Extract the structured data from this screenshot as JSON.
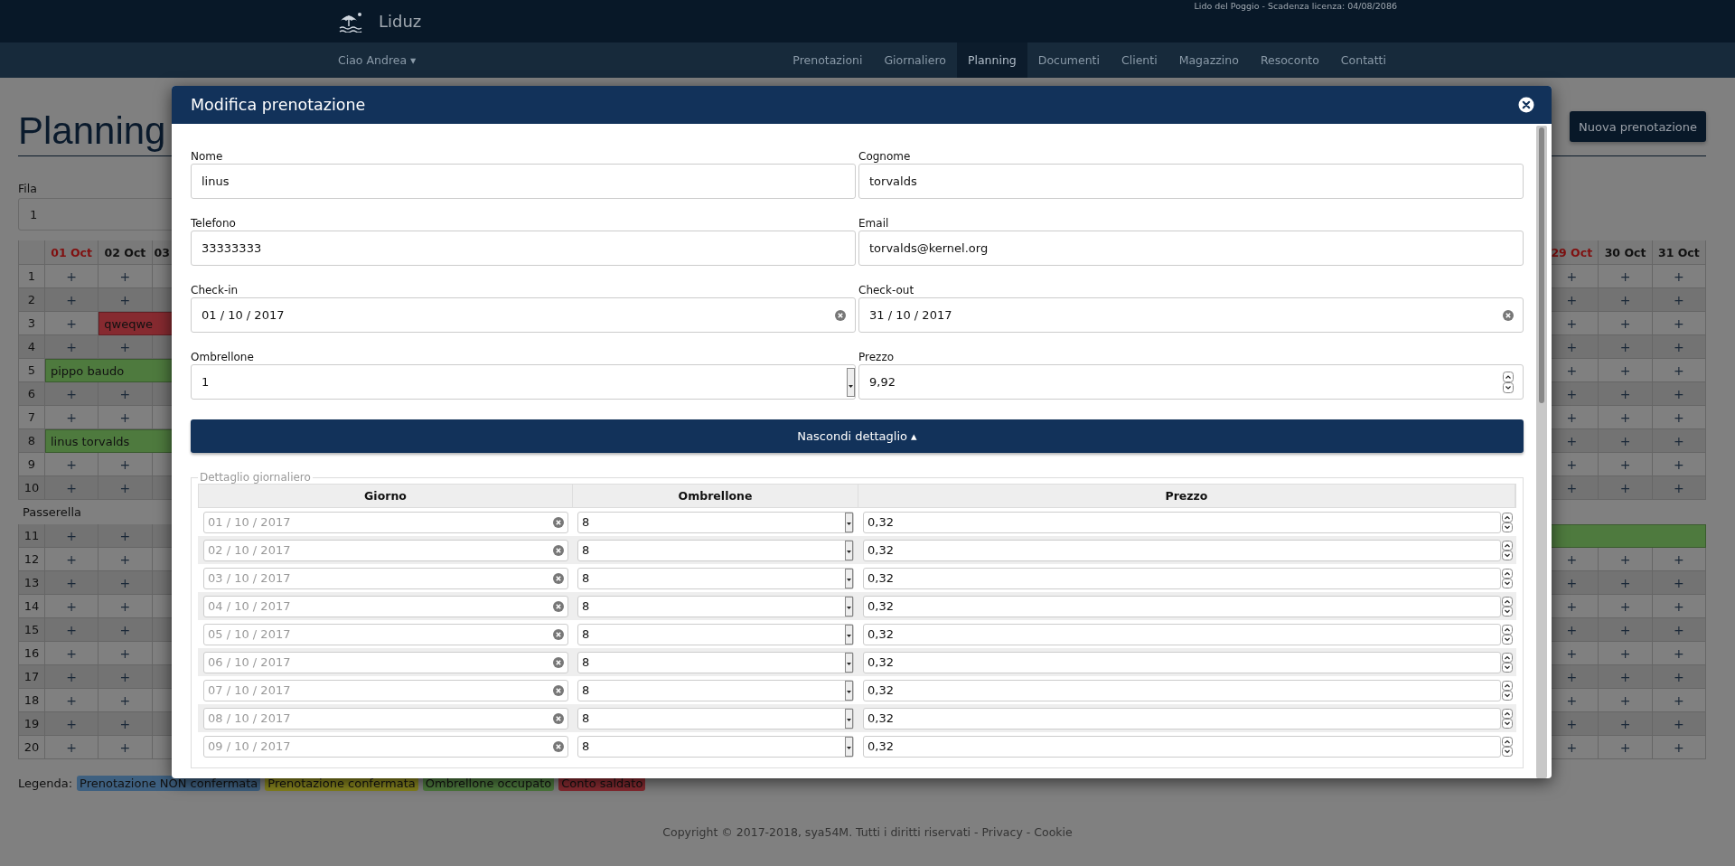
{
  "topbar": {
    "brand": "Liduz",
    "license": "Lido del Poggio - Scadenza licenza: 04/08/2086"
  },
  "nav": {
    "user": "Ciao Andrea ▾",
    "items": [
      {
        "label": "Prenotazioni",
        "selected": false
      },
      {
        "label": "Giornaliero",
        "selected": false
      },
      {
        "label": "Planning",
        "selected": true
      },
      {
        "label": "Documenti",
        "selected": false
      },
      {
        "label": "Clienti",
        "selected": false
      },
      {
        "label": "Magazzino",
        "selected": false
      },
      {
        "label": "Resoconto",
        "selected": false
      },
      {
        "label": "Contatti",
        "selected": false
      }
    ]
  },
  "page": {
    "title": "Planning",
    "new_button": "Nuova prenotazione",
    "fila": {
      "label": "Fila",
      "value": "1"
    }
  },
  "planning": {
    "columns_left": [
      {
        "label": "01 Oct",
        "weekend": true
      },
      {
        "label": "02 Oct",
        "weekend": false
      },
      {
        "label": "03",
        "weekend": false
      }
    ],
    "columns_right": [
      {
        "label": "29 Oct",
        "weekend": true
      },
      {
        "label": "30 Oct",
        "weekend": false
      },
      {
        "label": "31 Oct",
        "weekend": false
      }
    ],
    "rows": [
      {
        "kind": "row",
        "label": "1",
        "left": [
          {
            "kind": "free",
            "text": "+"
          },
          {
            "kind": "free",
            "text": "+"
          }
        ],
        "right": [
          {
            "kind": "free",
            "text": "+"
          },
          {
            "kind": "free",
            "text": "+"
          },
          {
            "kind": "free",
            "text": "+"
          }
        ]
      },
      {
        "kind": "row",
        "label": "2",
        "left": [
          {
            "kind": "free",
            "text": "+"
          },
          {
            "kind": "free",
            "text": "+"
          }
        ],
        "right": [
          {
            "kind": "free",
            "text": "+"
          },
          {
            "kind": "free",
            "text": "+"
          },
          {
            "kind": "free",
            "text": "+"
          }
        ]
      },
      {
        "kind": "row",
        "label": "3",
        "left": [
          {
            "kind": "free",
            "text": "+"
          },
          {
            "kind": "booking",
            "text": "qweqwe",
            "color": "#862a30"
          }
        ],
        "right": [
          {
            "kind": "free",
            "text": "+"
          },
          {
            "kind": "free",
            "text": "+"
          },
          {
            "kind": "free",
            "text": "+"
          }
        ]
      },
      {
        "kind": "row",
        "label": "4",
        "left": [
          {
            "kind": "free",
            "text": "+"
          },
          {
            "kind": "free",
            "text": "+"
          }
        ],
        "right": [
          {
            "kind": "free",
            "text": "+"
          },
          {
            "kind": "free",
            "text": "+"
          },
          {
            "kind": "free",
            "text": "+"
          }
        ]
      },
      {
        "kind": "row",
        "label": "5",
        "left": [
          {
            "kind": "booking",
            "text": "pippo baudo",
            "color": "#4e7a3e"
          }
        ],
        "right": [
          {
            "kind": "free",
            "text": "+"
          },
          {
            "kind": "free",
            "text": "+"
          },
          {
            "kind": "free",
            "text": "+"
          }
        ]
      },
      {
        "kind": "row",
        "label": "6",
        "left": [
          {
            "kind": "free",
            "text": "+"
          },
          {
            "kind": "free",
            "text": "+"
          }
        ],
        "right": [
          {
            "kind": "free",
            "text": "+"
          },
          {
            "kind": "free",
            "text": "+"
          },
          {
            "kind": "free",
            "text": "+"
          }
        ]
      },
      {
        "kind": "row",
        "label": "7",
        "left": [
          {
            "kind": "free",
            "text": "+"
          },
          {
            "kind": "free",
            "text": "+"
          }
        ],
        "right": [
          {
            "kind": "free",
            "text": "+"
          },
          {
            "kind": "free",
            "text": "+"
          },
          {
            "kind": "free",
            "text": "+"
          }
        ]
      },
      {
        "kind": "row",
        "label": "8",
        "left": [
          {
            "kind": "booking",
            "text": "linus torvalds",
            "color": "#4e7a3e"
          }
        ],
        "right": [
          {
            "kind": "free",
            "text": "+"
          },
          {
            "kind": "free",
            "text": "+"
          },
          {
            "kind": "free",
            "text": "+"
          }
        ]
      },
      {
        "kind": "row",
        "label": "9",
        "left": [
          {
            "kind": "free",
            "text": "+"
          },
          {
            "kind": "free",
            "text": "+"
          }
        ],
        "right": [
          {
            "kind": "free",
            "text": "+"
          },
          {
            "kind": "free",
            "text": "+"
          },
          {
            "kind": "free",
            "text": "+"
          }
        ]
      },
      {
        "kind": "row",
        "label": "10",
        "left": [
          {
            "kind": "free",
            "text": "+"
          },
          {
            "kind": "free",
            "text": "+"
          }
        ],
        "right": [
          {
            "kind": "free",
            "text": "+"
          },
          {
            "kind": "free",
            "text": "+"
          },
          {
            "kind": "free",
            "text": "+"
          }
        ]
      },
      {
        "kind": "section",
        "label": "Passerella"
      },
      {
        "kind": "row",
        "label": "11",
        "left": [
          {
            "kind": "free",
            "text": "+"
          },
          {
            "kind": "free",
            "text": "+"
          }
        ],
        "right": [
          {
            "kind": "booking",
            "color": "#4e7a3e"
          }
        ]
      },
      {
        "kind": "row",
        "label": "12",
        "left": [
          {
            "kind": "free",
            "text": "+"
          },
          {
            "kind": "free",
            "text": "+"
          }
        ],
        "right": [
          {
            "kind": "free",
            "text": "+"
          },
          {
            "kind": "free",
            "text": "+"
          },
          {
            "kind": "free",
            "text": "+"
          }
        ]
      },
      {
        "kind": "row",
        "label": "13",
        "left": [
          {
            "kind": "free",
            "text": "+"
          },
          {
            "kind": "free",
            "text": "+"
          }
        ],
        "right": [
          {
            "kind": "free",
            "text": "+"
          },
          {
            "kind": "free",
            "text": "+"
          },
          {
            "kind": "free",
            "text": "+"
          }
        ]
      },
      {
        "kind": "row",
        "label": "14",
        "left": [
          {
            "kind": "free",
            "text": "+"
          },
          {
            "kind": "free",
            "text": "+"
          }
        ],
        "right": [
          {
            "kind": "free",
            "text": "+"
          },
          {
            "kind": "free",
            "text": "+"
          },
          {
            "kind": "free",
            "text": "+"
          }
        ]
      },
      {
        "kind": "row",
        "label": "15",
        "left": [
          {
            "kind": "free",
            "text": "+"
          },
          {
            "kind": "free",
            "text": "+"
          }
        ],
        "right": [
          {
            "kind": "free",
            "text": "+"
          },
          {
            "kind": "free",
            "text": "+"
          },
          {
            "kind": "free",
            "text": "+"
          }
        ]
      },
      {
        "kind": "row",
        "label": "16",
        "left": [
          {
            "kind": "free",
            "text": "+"
          },
          {
            "kind": "free",
            "text": "+"
          }
        ],
        "right": [
          {
            "kind": "free",
            "text": "+"
          },
          {
            "kind": "free",
            "text": "+"
          },
          {
            "kind": "free",
            "text": "+"
          }
        ]
      },
      {
        "kind": "row",
        "label": "17",
        "left": [
          {
            "kind": "free",
            "text": "+"
          },
          {
            "kind": "free",
            "text": "+"
          }
        ],
        "right": [
          {
            "kind": "free",
            "text": "+"
          },
          {
            "kind": "free",
            "text": "+"
          },
          {
            "kind": "free",
            "text": "+"
          }
        ]
      },
      {
        "kind": "row",
        "label": "18",
        "left": [
          {
            "kind": "free",
            "text": "+"
          },
          {
            "kind": "free",
            "text": "+"
          }
        ],
        "right": [
          {
            "kind": "free",
            "text": "+"
          },
          {
            "kind": "free",
            "text": "+"
          },
          {
            "kind": "free",
            "text": "+"
          }
        ]
      },
      {
        "kind": "row",
        "label": "19",
        "left": [
          {
            "kind": "free",
            "text": "+"
          },
          {
            "kind": "free",
            "text": "+"
          }
        ],
        "right": [
          {
            "kind": "free",
            "text": "+"
          },
          {
            "kind": "free",
            "text": "+"
          },
          {
            "kind": "free",
            "text": "+"
          }
        ]
      },
      {
        "kind": "row",
        "label": "20",
        "left": [
          {
            "kind": "free",
            "text": "+"
          },
          {
            "kind": "free",
            "text": "+"
          }
        ],
        "right": [
          {
            "kind": "free",
            "text": "+"
          },
          {
            "kind": "free",
            "text": "+"
          },
          {
            "kind": "free",
            "text": "+"
          }
        ]
      }
    ]
  },
  "legend": {
    "label": "Legenda:",
    "items": [
      {
        "label": "Prenotazione NON confermata",
        "color": "#3e6080"
      },
      {
        "label": "Prenotazione confermata",
        "color": "#85821e"
      },
      {
        "label": "Ombrellone occupato",
        "color": "#4e7a3e"
      },
      {
        "label": "Conto saldato",
        "color": "#862a30"
      }
    ]
  },
  "footer": {
    "text": "Copyright © 2017-2018, sya54M. Tutti i diritti riservati",
    "separator": "-",
    "links": [
      "Privacy",
      "Cookie"
    ]
  },
  "modal": {
    "title": "Modifica prenotazione",
    "fields": [
      {
        "label": "Nome",
        "kind": "text",
        "value": "linus"
      },
      {
        "label": "Cognome",
        "kind": "text",
        "value": "torvalds"
      },
      {
        "label": "Telefono",
        "kind": "text",
        "value": "33333333"
      },
      {
        "label": "Email",
        "kind": "text",
        "value": "torvalds@kernel.org"
      },
      {
        "label": "Check-in",
        "kind": "date",
        "value": "01 / 10 / 2017"
      },
      {
        "label": "Check-out",
        "kind": "date",
        "value": "31 / 10 / 2017"
      },
      {
        "label": "Ombrellone",
        "kind": "select",
        "value": "1"
      },
      {
        "label": "Prezzo",
        "kind": "number",
        "value": "9,92"
      }
    ],
    "toggle_button": "Nascondi dettaglio ▴",
    "detail": {
      "legend": "Dettaglio giornaliero",
      "columns": [
        "Giorno",
        "Ombrellone",
        "Prezzo"
      ],
      "rows": [
        {
          "day": "01 / 10 / 2017",
          "day_disabled": true,
          "umbrella": "8",
          "price": "0,32"
        },
        {
          "day": "02 / 10 / 2017",
          "day_disabled": true,
          "umbrella": "8",
          "price": "0,32"
        },
        {
          "day": "03 / 10 / 2017",
          "day_disabled": true,
          "umbrella": "8",
          "price": "0,32"
        },
        {
          "day": "04 / 10 / 2017",
          "day_disabled": true,
          "umbrella": "8",
          "price": "0,32"
        },
        {
          "day": "05 / 10 / 2017",
          "day_disabled": true,
          "umbrella": "8",
          "price": "0,32"
        },
        {
          "day": "06 / 10 / 2017",
          "day_disabled": true,
          "umbrella": "8",
          "price": "0,32"
        },
        {
          "day": "07 / 10 / 2017",
          "day_disabled": true,
          "umbrella": "8",
          "price": "0,32"
        },
        {
          "day": "08 / 10 / 2017",
          "day_disabled": true,
          "umbrella": "8",
          "price": "0,32"
        },
        {
          "day": "09 / 10 / 2017",
          "day_disabled": true,
          "umbrella": "8",
          "price": "0,32"
        }
      ]
    }
  }
}
